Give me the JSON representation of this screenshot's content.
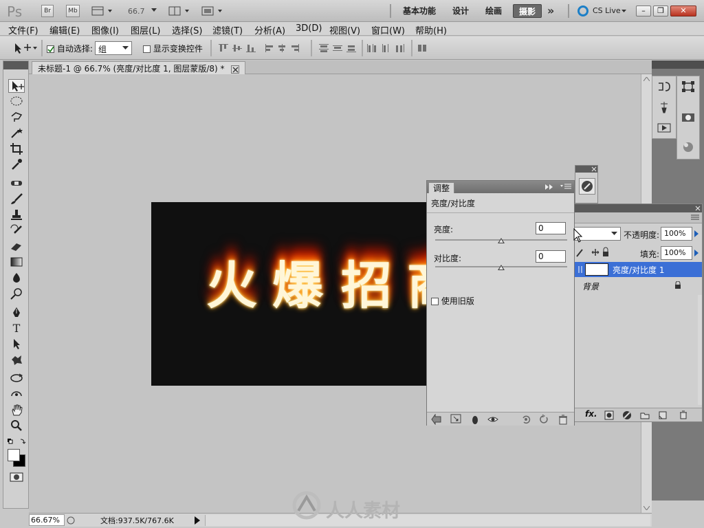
{
  "app": {
    "logo": "Ps",
    "bridge_label": "Br",
    "minibridge_label": "Mb",
    "zoom_value": "66.7",
    "workspaces": [
      "基本功能",
      "设计",
      "绘画",
      "摄影"
    ],
    "active_workspace": "摄影",
    "more_label": "»",
    "cs_live": "CS Live"
  },
  "menu": [
    "文件(F)",
    "编辑(E)",
    "图像(I)",
    "图层(L)",
    "选择(S)",
    "滤镜(T)",
    "分析(A)",
    "3D(D)",
    "视图(V)",
    "窗口(W)",
    "帮助(H)"
  ],
  "options": {
    "auto_select_label": "自动选择:",
    "auto_select_checked": true,
    "auto_select_value": "组",
    "show_transform_label": "显示变换控件",
    "show_transform_checked": false
  },
  "document": {
    "tab_title": "未标题-1 @ 66.7% (亮度/对比度 1, 图层蒙版/8) *",
    "canvas_text": [
      "火",
      "爆",
      "招",
      "商"
    ]
  },
  "status": {
    "zoom": "66.67%",
    "doc_info": "文档:937.5K/767.6K"
  },
  "adjustments": {
    "tab_label": "调整",
    "heading": "亮度/对比度",
    "brightness_label": "亮度:",
    "brightness_value": "0",
    "contrast_label": "对比度:",
    "contrast_value": "0",
    "legacy_label": "使用旧版",
    "legacy_checked": false
  },
  "layers": {
    "opacity_label": "不透明度:",
    "opacity_value": "100%",
    "fill_label": "填充:",
    "fill_value": "100%",
    "rows": [
      {
        "name": "亮度/对比度 1",
        "selected": true
      },
      {
        "name": "背景",
        "selected": false
      }
    ]
  },
  "watermark": {
    "text": "人人素材"
  },
  "colors": {
    "accent_selected": "#3b6fd6",
    "panel_bg": "#d6d6d6",
    "active_workspace_bg": "#6a6a6a"
  }
}
